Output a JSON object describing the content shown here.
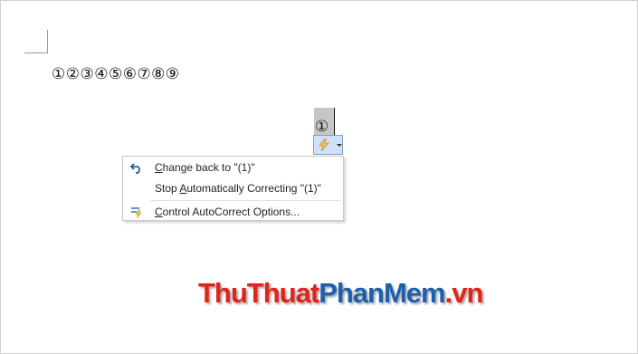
{
  "document": {
    "circled_numbers": "①②③④⑤⑥⑦⑧⑨",
    "selected_char": "①"
  },
  "autocorrect_button": {
    "icon": "lightning-bolt-icon"
  },
  "menu": {
    "items": [
      {
        "pre": "",
        "key": "C",
        "post": "hange back to \"(1)\"",
        "icon": "undo-arrow-icon"
      },
      {
        "pre": "Stop ",
        "key": "A",
        "post": "utomatically Correcting \"(1)\"",
        "icon": ""
      },
      {
        "pre": "",
        "key": "C",
        "post": "ontrol AutoCorrect Options...",
        "icon": "autocorrect-options-icon"
      }
    ]
  },
  "watermark": {
    "part1": "ThuThuat",
    "part2": "PhanMem",
    "part3": ".vn"
  },
  "colors": {
    "button_bg": "#cfe0f7",
    "button_border": "#7da2ce",
    "watermark_red": "#e2231a",
    "watermark_blue": "#1b5fae"
  }
}
